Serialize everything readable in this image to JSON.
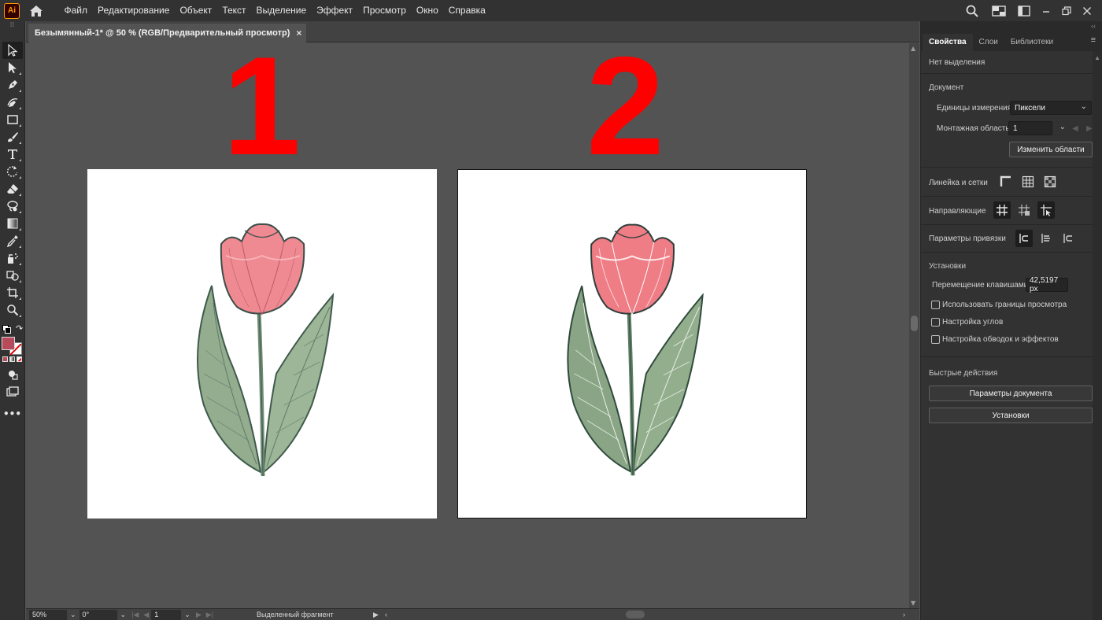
{
  "app": {
    "logo": "Ai",
    "menu": [
      "Файл",
      "Редактирование",
      "Объект",
      "Текст",
      "Выделение",
      "Эффект",
      "Просмотр",
      "Окно",
      "Справка"
    ]
  },
  "document": {
    "tab_title": "Безымянный-1* @ 50 % (RGB/Предварительный просмотр)",
    "tab_close": "×",
    "artboard_labels": [
      "1",
      "2"
    ]
  },
  "statusbar": {
    "zoom": "50%",
    "rotation": "0°",
    "artboard_number": "1",
    "selection_info": "Выделенный фрагмент"
  },
  "properties": {
    "tabs": [
      "Свойства",
      "Слои",
      "Библиотеки"
    ],
    "no_selection": "Нет выделения",
    "document_section": "Документ",
    "units_label": "Единицы измерения:",
    "units_value": "Пиксели",
    "artboard_label": "Монтажная область:",
    "artboard_value": "1",
    "edit_artboards_button": "Изменить области",
    "rulers_grids_label": "Линейка и сетки",
    "guides_label": "Направляющие",
    "snap_options_label": "Параметры привязки",
    "preferences_section": "Установки",
    "keyboard_increment_label": "Перемещение клавишами:",
    "keyboard_increment_value": "42,5197 px",
    "use_preview_bounds": "Использовать границы просмотра",
    "scale_corners": "Настройка углов",
    "scale_strokes_effects": "Настройка обводок и эффектов",
    "quick_actions_section": "Быстрые действия",
    "document_setup_button": "Параметры документа",
    "preferences_button": "Установки"
  },
  "colors": {
    "fill_swatch": "#b84b5b",
    "accent_red_numbers": "#ff0000",
    "app_logo_orange": "#ff9a00"
  }
}
